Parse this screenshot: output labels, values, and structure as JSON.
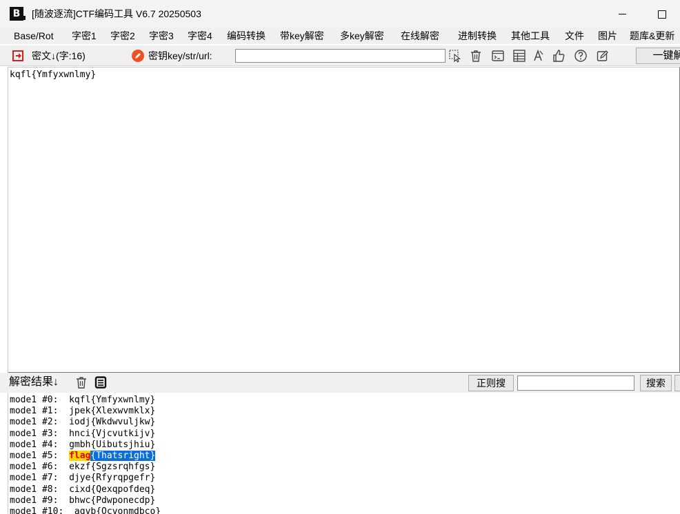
{
  "window": {
    "title": "[随波逐流]CTF编码工具 V6.7  20250503",
    "logo_text": "B"
  },
  "menu": {
    "items": [
      "Base/Rot",
      "字密1",
      "字密2",
      "字密3",
      "字密4",
      "编码转换",
      "带key解密",
      "多key解密",
      "在线解密",
      "进制转换",
      "其他工具",
      "文件",
      "图片",
      "题库&更新"
    ]
  },
  "toolbar": {
    "cipher_label": "密文↓(字:16)",
    "key_label": "密钥key/str/url:",
    "key_value": "",
    "one_key_button": "一键解"
  },
  "editor": {
    "ciphertext": "kqfl{Ymfyxwnlmy}"
  },
  "results_bar": {
    "label": "解密结果↓",
    "regex_button": "正则搜",
    "search_value": "",
    "search_button": "搜索"
  },
  "results": {
    "rows": [
      {
        "prefix": "mode1 #0:  ",
        "text": "kqfl{Ymfyxwnlmy}"
      },
      {
        "prefix": "mode1 #1:  ",
        "text": "jpek{Xlexwvmklx}"
      },
      {
        "prefix": "mode1 #2:  ",
        "text": "iodj{Wkdwvuljkw}"
      },
      {
        "prefix": "mode1 #3:  ",
        "text": "hnci{Vjcvutkijv}"
      },
      {
        "prefix": "mode1 #4:  ",
        "text": "gmbh{Uibutsjhiu}"
      },
      {
        "prefix": "mode1 #5:  ",
        "text": "flag{Thatsright}",
        "flag": "flag",
        "rest": "{Thatsright}"
      },
      {
        "prefix": "mode1 #6:  ",
        "text": "ekzf{Sgzsrqhfgs}"
      },
      {
        "prefix": "mode1 #7:  ",
        "text": "djye{Rfyrqpgefr}"
      },
      {
        "prefix": "mode1 #8:  ",
        "text": "cixd{Qexqpofdeq}"
      },
      {
        "prefix": "mode1 #9:  ",
        "text": "bhwc{Pdwponecdp}"
      },
      {
        "prefix": "mode1 #10:  ",
        "text": "agvb{Ocvonmdbco}"
      }
    ]
  },
  "colors": {
    "flag_highlight_bg": "#ffd700",
    "flag_text": "#e00000",
    "selection_bg": "#0a6fd8"
  }
}
